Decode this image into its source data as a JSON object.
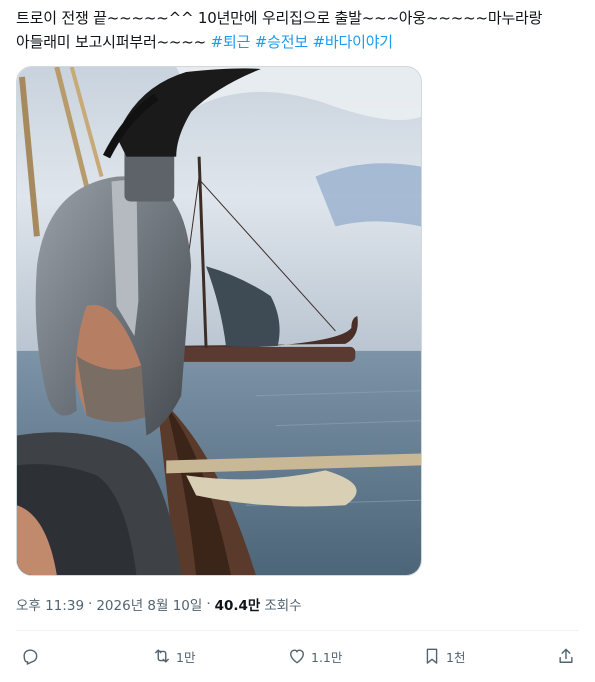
{
  "tweet": {
    "text": "트로이 전쟁 끝~~~~~^^ 10년만에 우리집으로 출발~~~아웅~~~~~마누라랑 아들래미 보고시퍼부러~~~~ ",
    "hashtags": [
      "#퇴근",
      "#승전보",
      "#바다이야기"
    ]
  },
  "meta": {
    "time": "오후 11:39",
    "sep1": "·",
    "date": "2026년 8월 10일",
    "sep2": "·",
    "views": "40.4만",
    "views_label": "조회수"
  },
  "actions": {
    "reply_count": "",
    "retweet_count": "1만",
    "like_count": "1.1만",
    "bookmark_count": "1천"
  },
  "icons": {
    "reply": "reply-icon",
    "retweet": "retweet-icon",
    "like": "heart-icon",
    "bookmark": "bookmark-icon",
    "share": "share-icon"
  },
  "colors": {
    "hashtag": "#1d9bf0",
    "secondary_text": "#536471",
    "primary_text": "#0f1419"
  }
}
